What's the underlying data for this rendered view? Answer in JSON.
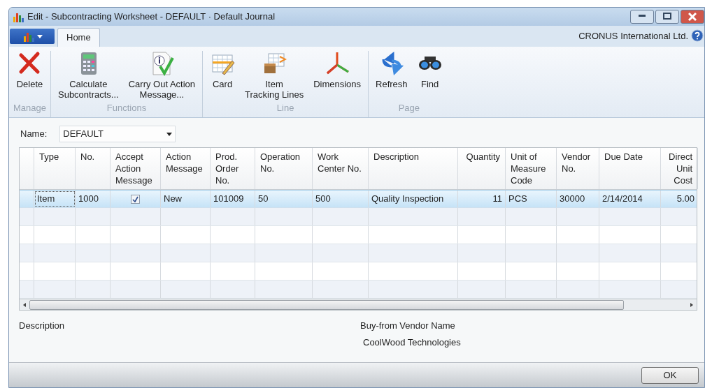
{
  "window": {
    "title": "Edit - Subcontracting Worksheet - DEFAULT · Default Journal"
  },
  "tabs": [
    {
      "label": "Home",
      "selected": true
    }
  ],
  "company": "CRONUS International Ltd.",
  "ribbon_groups": [
    {
      "label": "Manage",
      "actions": [
        {
          "label": "Delete"
        }
      ]
    },
    {
      "label": "Functions",
      "actions": [
        {
          "label": "Calculate\nSubcontracts..."
        },
        {
          "label": "Carry Out Action\nMessage..."
        }
      ]
    },
    {
      "label": "Line",
      "actions": [
        {
          "label": "Card"
        },
        {
          "label": "Item\nTracking Lines"
        },
        {
          "label": "Dimensions"
        }
      ]
    },
    {
      "label": "Page",
      "actions": [
        {
          "label": "Refresh"
        },
        {
          "label": "Find"
        }
      ]
    }
  ],
  "name_field": {
    "label": "Name:",
    "value": "DEFAULT"
  },
  "table": {
    "columns": [
      {
        "label": "Type",
        "numeric": false
      },
      {
        "label": "No.",
        "numeric": false
      },
      {
        "label": "Accept\nAction\nMessage",
        "numeric": false
      },
      {
        "label": "Action\nMessage",
        "numeric": false
      },
      {
        "label": "Prod.\nOrder\nNo.",
        "numeric": false
      },
      {
        "label": "Operation\nNo.",
        "numeric": false
      },
      {
        "label": "Work\nCenter No.",
        "numeric": false
      },
      {
        "label": "Description",
        "numeric": false
      },
      {
        "label": "Quantity",
        "numeric": true
      },
      {
        "label": "Unit of\nMeasure\nCode",
        "numeric": false
      },
      {
        "label": "Vendor\nNo.",
        "numeric": false
      },
      {
        "label": "Due Date",
        "numeric": false
      },
      {
        "label": "Direct\nUnit\nCost",
        "numeric": true
      }
    ],
    "rows": [
      {
        "selected": true,
        "cells": [
          "Item",
          "1000",
          {
            "checked": true
          },
          "New",
          "101009",
          "50",
          "500",
          "Quality Inspection",
          "11",
          "PCS",
          "30000",
          "2/14/2014",
          "5.00"
        ]
      }
    ]
  },
  "details": {
    "description_label": "Description",
    "vendor_label": "Buy-from Vendor Name",
    "vendor_value": "CoolWood Technologies"
  },
  "buttons": [
    "OK"
  ]
}
